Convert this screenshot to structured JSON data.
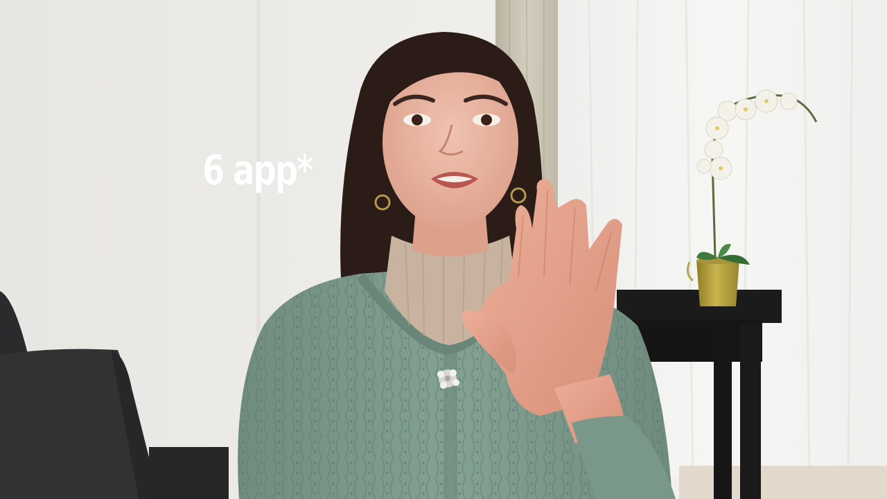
{
  "video_frame": {
    "overlay_caption": "6 app*"
  },
  "colors": {
    "wall": "#ecebe8",
    "curtain_sheer": "#f2f2f0",
    "curtain_beige": "#c9c3b2",
    "sweater_sage": "#7c9a8c",
    "turtleneck_beige": "#c8b3a0",
    "skin": "#e4ab96",
    "hair": "#2c1c18",
    "sofa_dark": "#2b2b2d",
    "table_black": "#1b1b1b",
    "planter_gold": "#b4a03e",
    "orchid_white": "#f4f1e8",
    "floor": "#e2d9cc",
    "caption_text": "#ffffff"
  }
}
